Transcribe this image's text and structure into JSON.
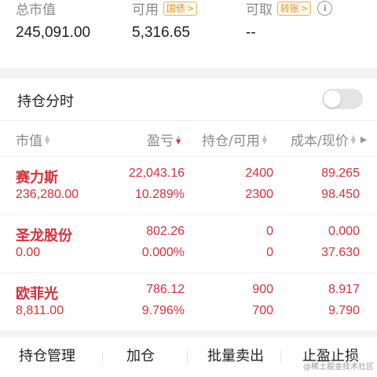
{
  "summary": {
    "market_value": {
      "label": "总市值",
      "value": "245,091.00"
    },
    "available": {
      "label": "可用",
      "tag": "国债",
      "value": "5,316.65"
    },
    "withdrawable": {
      "label": "可取",
      "tag": "转账",
      "value": "--"
    }
  },
  "toggle": {
    "label": "持仓分时",
    "on": false
  },
  "columns": {
    "market_value": "市值",
    "profit_loss": "盈亏",
    "position": "持仓/可用",
    "cost_price": "成本/现价"
  },
  "holdings": [
    {
      "name": "赛力斯",
      "market_value": "236,280.00",
      "pl": "22,043.16",
      "pl_pct": "10.289%",
      "position": "2400",
      "available": "2300",
      "cost": "89.265",
      "price": "98.450"
    },
    {
      "name": "圣龙股份",
      "market_value": "0.00",
      "pl": "802.26",
      "pl_pct": "0.000%",
      "position": "0",
      "available": "0",
      "cost": "0.000",
      "price": "37.630"
    },
    {
      "name": "欧菲光",
      "market_value": "8,811.00",
      "pl": "786.12",
      "pl_pct": "9.796%",
      "position": "900",
      "available": "700",
      "cost": "8.917",
      "price": "9.790"
    }
  ],
  "actions": {
    "manage": "持仓管理",
    "add": "加仓",
    "batch_sell": "批量卖出",
    "stop": "止盈止损"
  },
  "watermark": "@稀土掘金技术社区",
  "colors": {
    "red": "#d9303a",
    "tag": "#d89a2b",
    "muted": "#8a8a8a"
  }
}
